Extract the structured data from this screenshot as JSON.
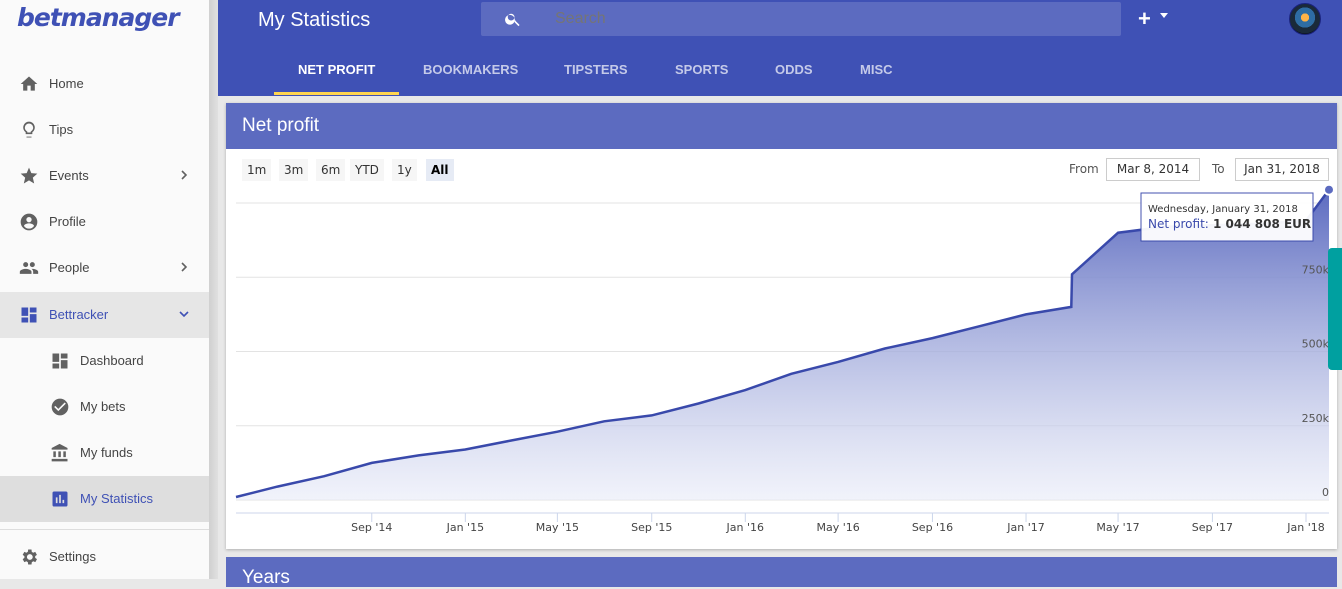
{
  "app": {
    "logo": "betmanager"
  },
  "sidebar": {
    "items": [
      {
        "label": "Home",
        "icon": "home-icon"
      },
      {
        "label": "Tips",
        "icon": "lightbulb-icon"
      },
      {
        "label": "Events",
        "icon": "star-icon"
      },
      {
        "label": "Profile",
        "icon": "account-circle-icon"
      },
      {
        "label": "People",
        "icon": "people-icon"
      },
      {
        "label": "Bettracker",
        "icon": "dashboard-icon"
      },
      {
        "label": "Dashboard",
        "icon": "dashboard-icon"
      },
      {
        "label": "My bets",
        "icon": "check-circle-icon"
      },
      {
        "label": "My funds",
        "icon": "bank-icon"
      },
      {
        "label": "My Statistics",
        "icon": "bar-chart-icon"
      },
      {
        "label": "Settings",
        "icon": "gear-icon"
      }
    ]
  },
  "header": {
    "title": "My Statistics",
    "search_placeholder": "Search",
    "add_label": "+"
  },
  "tabs": [
    {
      "label": "NET PROFIT",
      "active": true
    },
    {
      "label": "BOOKMAKERS"
    },
    {
      "label": "TIPSTERS"
    },
    {
      "label": "SPORTS"
    },
    {
      "label": "ODDS"
    },
    {
      "label": "MISC"
    }
  ],
  "card": {
    "title": "Net profit",
    "ranges": [
      "1m",
      "3m",
      "6m",
      "YTD",
      "1y",
      "All"
    ],
    "active_range": "All",
    "from_label": "From",
    "from_value": "Mar 8, 2014",
    "to_label": "To",
    "to_value": "Jan 31, 2018",
    "tooltip": {
      "date": "Wednesday, January 31, 2018",
      "series_label": "Net profit:",
      "value": "1 044 808 EUR"
    }
  },
  "years_card": {
    "title": "Years"
  },
  "colors": {
    "primary": "#3f51b5",
    "card_header": "#5c6bc0",
    "accent": "#ffd54f",
    "line": "#3949ab"
  },
  "chart_data": {
    "type": "area",
    "title": "",
    "x_ticks": [
      "Sep '14",
      "Jan '15",
      "May '15",
      "Sep '15",
      "Jan '16",
      "May '16",
      "Sep '16",
      "Jan '17",
      "May '17",
      "Sep '17",
      "Jan '18"
    ],
    "y_ticks": [
      "0",
      "250k",
      "500k",
      "750k"
    ],
    "ylim": [
      0,
      1000000
    ],
    "series": [
      {
        "name": "Net profit",
        "x": [
          "2014-03-08",
          "2014-05-01",
          "2014-07-01",
          "2014-09-01",
          "2014-11-01",
          "2015-01-01",
          "2015-03-01",
          "2015-05-01",
          "2015-07-01",
          "2015-09-01",
          "2015-11-01",
          "2016-01-01",
          "2016-03-01",
          "2016-05-01",
          "2016-07-01",
          "2016-09-01",
          "2016-11-01",
          "2017-01-01",
          "2017-03-01",
          "2017-03-02",
          "2017-05-01",
          "2017-07-01",
          "2017-09-01",
          "2017-11-01",
          "2018-01-01",
          "2018-01-31"
        ],
        "values": [
          10000,
          45000,
          80000,
          125000,
          150000,
          170000,
          200000,
          230000,
          265000,
          285000,
          325000,
          370000,
          425000,
          465000,
          510000,
          545000,
          585000,
          625000,
          650000,
          760000,
          900000,
          920000,
          925000,
          930000,
          940000,
          1044808
        ]
      }
    ]
  }
}
